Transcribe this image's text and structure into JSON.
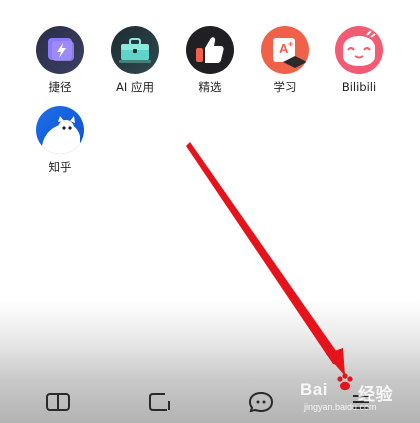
{
  "apps": [
    {
      "label": "捷径",
      "icon": "shortcut-icon"
    },
    {
      "label": "AI 应用",
      "icon": "ai-toolbox-icon"
    },
    {
      "label": "精选",
      "icon": "thumbs-up-icon"
    },
    {
      "label": "学习",
      "icon": "study-icon"
    },
    {
      "label": "Bilibili",
      "icon": "bilibili-icon"
    },
    {
      "label": "知乎",
      "icon": "zhihu-icon"
    }
  ],
  "nav": {
    "items": [
      "book-icon",
      "tab-icon",
      "chat-icon",
      "menu-icon"
    ]
  },
  "watermark": {
    "brand": "Bai",
    "brand_suffix": "经验",
    "sub": "jingyan.baidu.com"
  },
  "colors": {
    "arrow": "#e5131b",
    "study_icon": "#f0614a",
    "bili_icon": "#f35a73",
    "zhihu_icon": "#1f6ee8"
  }
}
